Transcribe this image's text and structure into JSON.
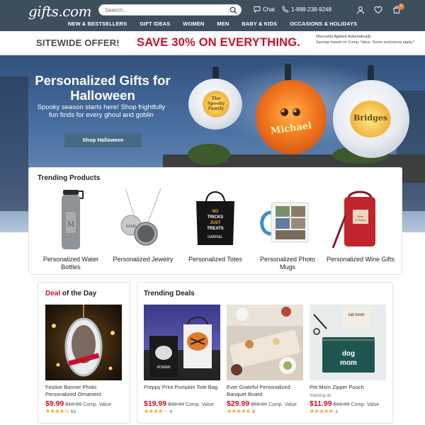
{
  "header": {
    "logo": "gifts.com",
    "search_placeholder": "Search...",
    "chat_label": "Chat",
    "phone": "1-888-238-9248",
    "cart_count": "0",
    "nav": [
      "NEW & BESTSELLERS",
      "GIFT IDEAS",
      "WOMEN",
      "MEN",
      "BABY & KIDS",
      "OCCASIONS & HOLIDAYS"
    ]
  },
  "promo": {
    "left": "SITEWIDE OFFER!",
    "main": "SAVE 30% ON EVERYTHING.",
    "note_title": "Discounts Applied Automatically",
    "note_body": "Savings based on Comp. Value. Some exclusions apply.*"
  },
  "hero": {
    "title": "Personalized Gifts for Halloween",
    "subtitle": "Spooky season starts here! Shop frightfully fun finds for every ghoul and goblin",
    "button": "Shop Halloween",
    "pumpkin_left": "The Spooky Family",
    "pumpkin_middle": "Michael",
    "pumpkin_right": "Bridges"
  },
  "trending_products": {
    "title": "Trending Products",
    "items": [
      {
        "label": "Personalized Water Bottles"
      },
      {
        "label": "Personalized Jewelry"
      },
      {
        "label": "Personalized Totes"
      },
      {
        "label": "Personalized Photo Mugs"
      },
      {
        "label": "Personalized Wine Gifts"
      }
    ],
    "tote_text": "NO TRICKS JUST TREATS",
    "tote_name": "GABRIEL"
  },
  "deal_of_day": {
    "title_red": "Deal",
    "title_rest": " of the Day",
    "name": "Festive Banner Photo Personalized Ornament",
    "price": "$9.99",
    "was": "$19.99",
    "comp": "Comp. Value",
    "stars": "★★★★½",
    "count": "63"
  },
  "trending_deals": {
    "title": "Trending Deals",
    "items": [
      {
        "name": "Preppy Print Pumpkin Tote Bag",
        "price": "$19.99",
        "was": "$39.99",
        "comp": "Comp. Value",
        "stars": "★★★★☆",
        "count": "4",
        "starting": ""
      },
      {
        "name": "Ever Grateful Personalized Banquet Board",
        "price": "$29.99",
        "was": "$59.99",
        "comp": "Comp. Value",
        "stars": "★★★★★",
        "count": "8",
        "starting": ""
      },
      {
        "name": "Pet Mom Zipper Pouch",
        "price": "$11.99",
        "was": "$19.99",
        "comp": "Comp. Value",
        "stars": "★★★★★",
        "count": "1",
        "starting": "Starting at"
      }
    ],
    "pouch_small": "cat mom",
    "pouch_big": "dog mom",
    "tote_name": "ROWAN"
  },
  "colors": {
    "header_bg": "#3e4f5c",
    "accent_red": "#c8102e",
    "button_bg": "#456a86",
    "star": "#f2a51a"
  }
}
